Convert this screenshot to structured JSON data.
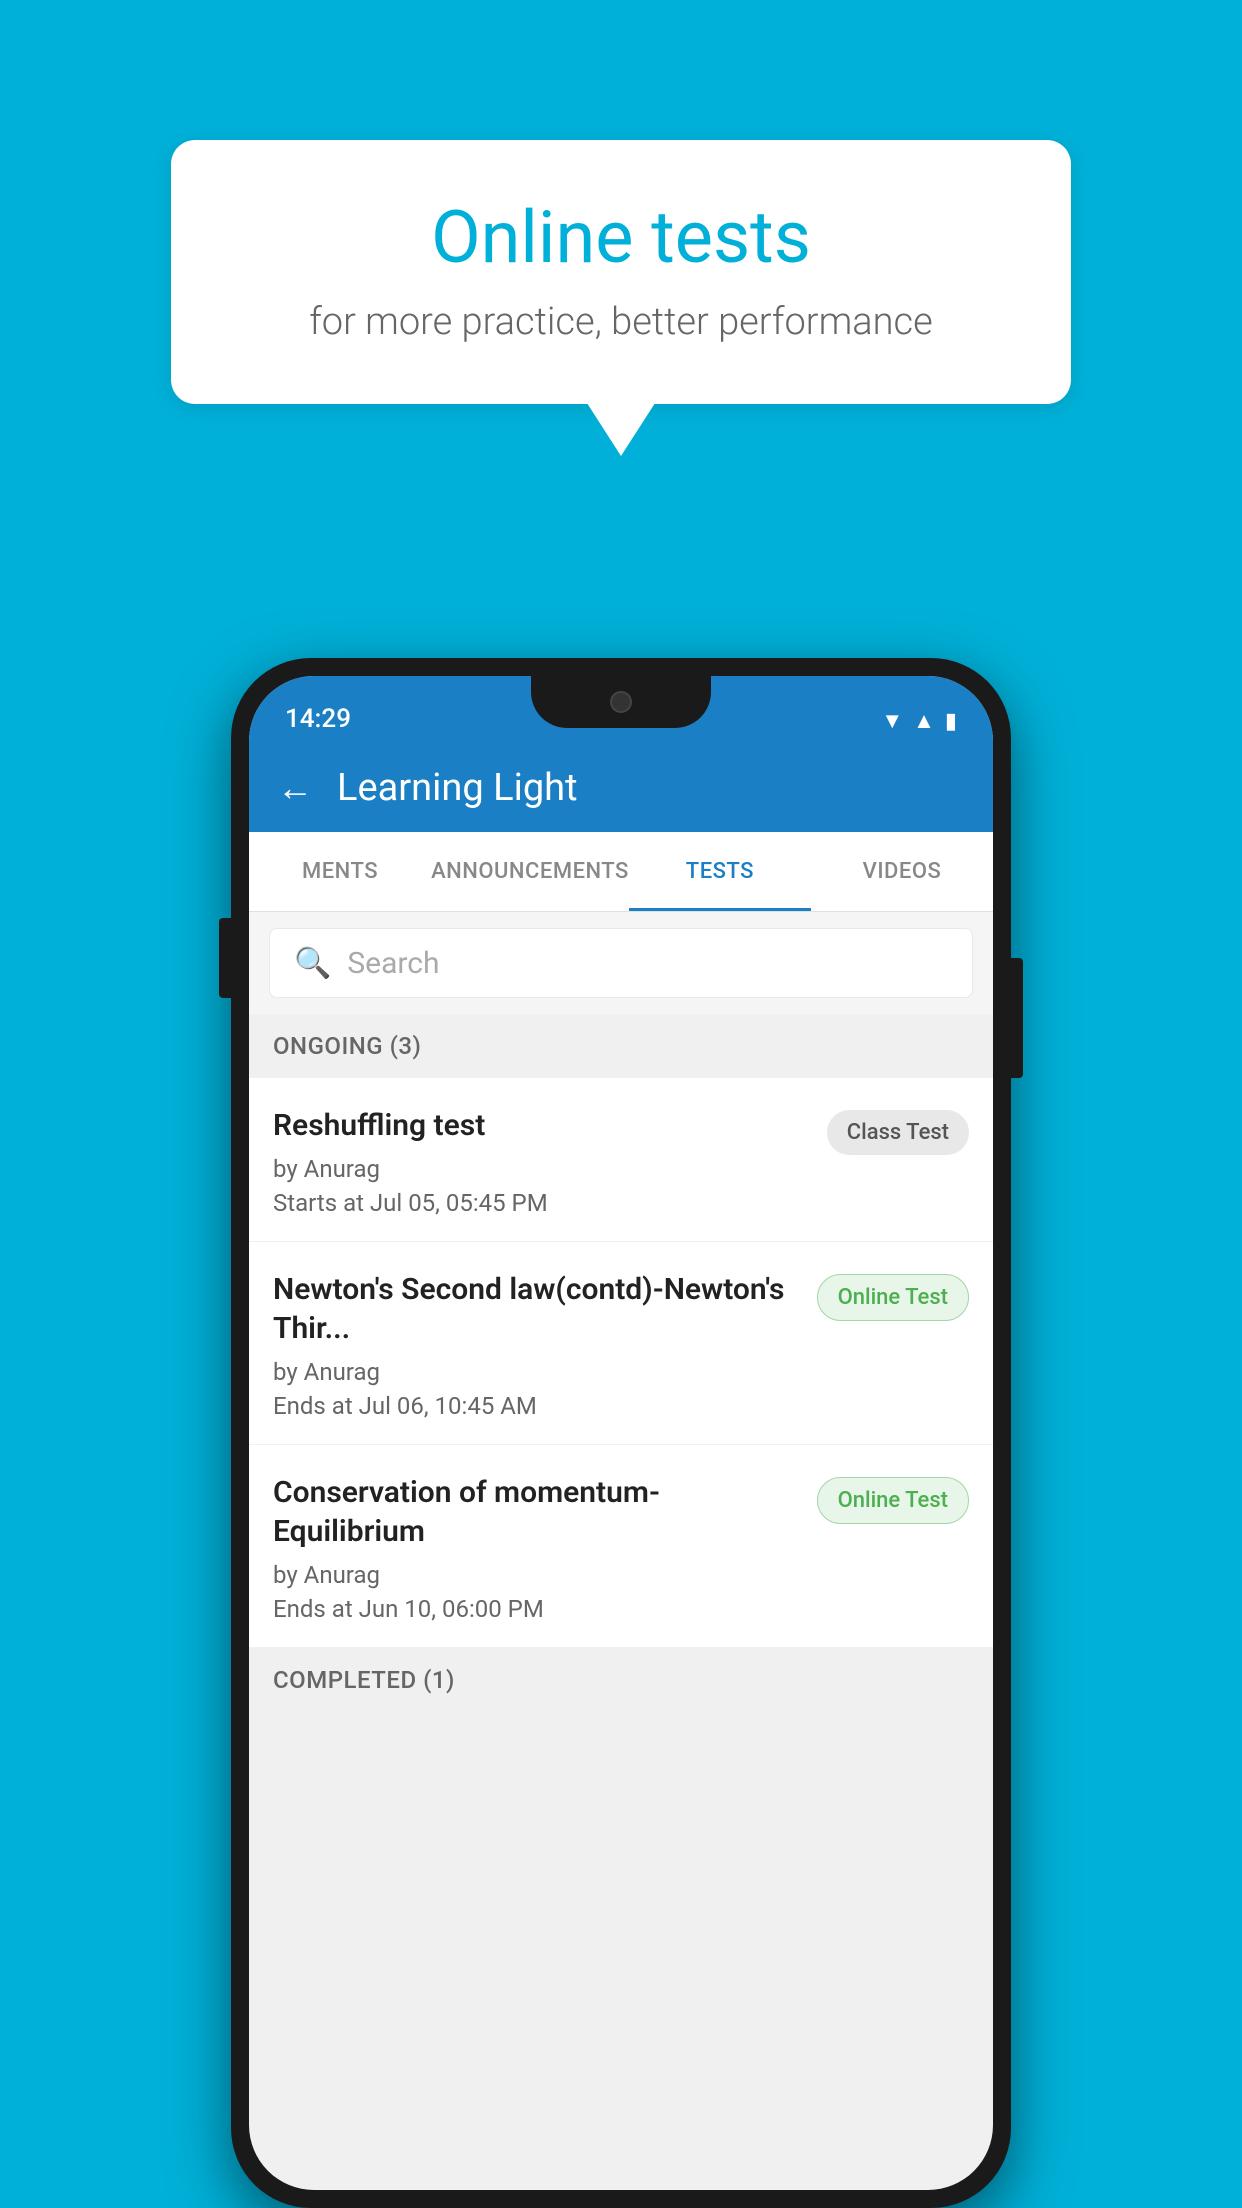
{
  "background": {
    "color": "#00b0d8"
  },
  "speech_bubble": {
    "title": "Online tests",
    "subtitle": "for more practice, better performance"
  },
  "phone": {
    "status_bar": {
      "time": "14:29",
      "icons": [
        "wifi",
        "signal",
        "battery"
      ]
    },
    "header": {
      "back_label": "←",
      "title": "Learning Light"
    },
    "tabs": [
      {
        "label": "MENTS",
        "active": false
      },
      {
        "label": "ANNOUNCEMENTS",
        "active": false
      },
      {
        "label": "TESTS",
        "active": true
      },
      {
        "label": "VIDEOS",
        "active": false
      }
    ],
    "search": {
      "placeholder": "Search"
    },
    "sections": [
      {
        "header": "ONGOING (3)",
        "items": [
          {
            "title": "Reshuffling test",
            "author": "by Anurag",
            "date": "Starts at  Jul 05, 05:45 PM",
            "badge": "Class Test",
            "badge_type": "class"
          },
          {
            "title": "Newton's Second law(contd)-Newton's Thir...",
            "author": "by Anurag",
            "date": "Ends at  Jul 06, 10:45 AM",
            "badge": "Online Test",
            "badge_type": "online"
          },
          {
            "title": "Conservation of momentum-Equilibrium",
            "author": "by Anurag",
            "date": "Ends at  Jun 10, 06:00 PM",
            "badge": "Online Test",
            "badge_type": "online"
          }
        ]
      },
      {
        "header": "COMPLETED (1)",
        "items": []
      }
    ]
  }
}
